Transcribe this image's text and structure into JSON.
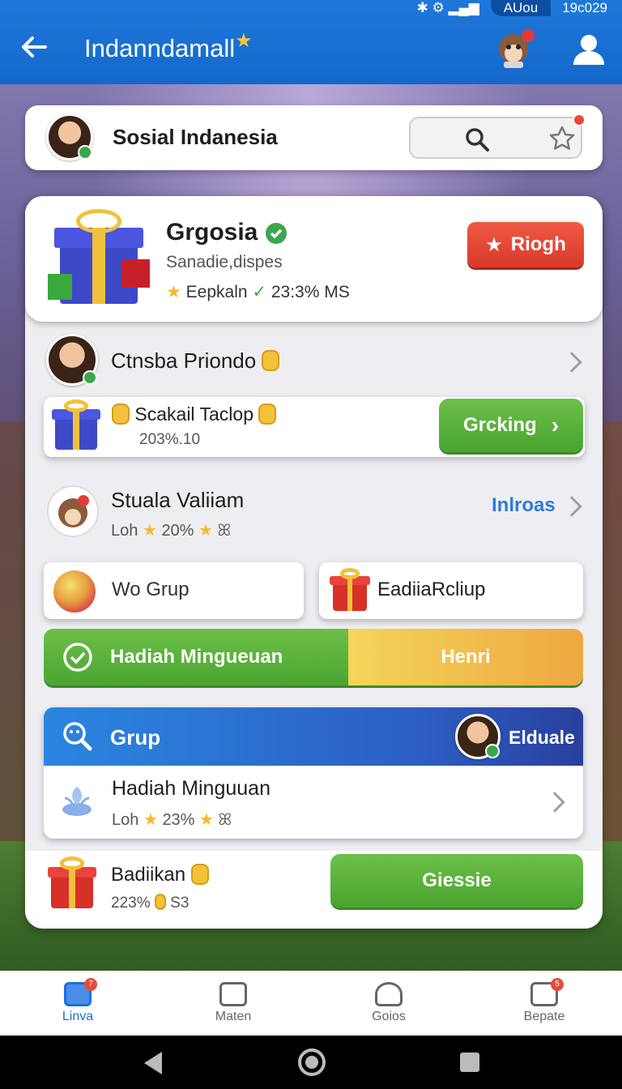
{
  "status_bar": {
    "carrier": "AUou",
    "time": "19c029"
  },
  "app_bar": {
    "title": "Indanndamall",
    "title_star": "★",
    "accent": "#1f78d9"
  },
  "group_header": {
    "name": "Sosial Indanesia",
    "search_icon": "search-icon",
    "favorite_icon": "star-icon"
  },
  "featured": {
    "name": "Grgosia",
    "subtitle": "Sanadie,dispes",
    "meta_label": "Eepkaln",
    "meta_value": "23:3% MS",
    "action_label": "Riogh",
    "action_color": "#e8473a"
  },
  "row_user": {
    "name": "Ctnsba Priondo"
  },
  "offer": {
    "title": "Scakail Taclop",
    "detail": "203%.10",
    "button": "Grcking"
  },
  "row_mascot": {
    "name": "Stuala Valiiam",
    "prefix": "Loh",
    "percent": "20%",
    "tail": "ꕤ",
    "link": "Inlroas"
  },
  "quick_actions": [
    {
      "label": "Wo Grup"
    },
    {
      "label": "EadiiaRcliup"
    }
  ],
  "split_banner": {
    "left": "Hadiah Minguеuan",
    "right": "Henri",
    "left_color": "#5fb23f",
    "right_color": "#f2c14a"
  },
  "group_section": {
    "header": "Grup",
    "header_user": "Elduale",
    "item_title": "Hadiah Minguuan",
    "item_prefix": "Loh",
    "item_percent": "23%",
    "item_tail": "ꕤ"
  },
  "reward_row": {
    "title": "Badiikan",
    "detail": "223%",
    "detail_tail": "S3",
    "button": "Giessie"
  },
  "bottom_nav": [
    {
      "label": "Linva",
      "icon": "home-icon",
      "badge": "7",
      "active": true
    },
    {
      "label": "Maten",
      "icon": "dice-icon",
      "badge": "",
      "active": false
    },
    {
      "label": "Goios",
      "icon": "person-icon",
      "badge": "",
      "active": false
    },
    {
      "label": "Bepate",
      "icon": "message-icon",
      "badge": "5",
      "active": false
    }
  ]
}
